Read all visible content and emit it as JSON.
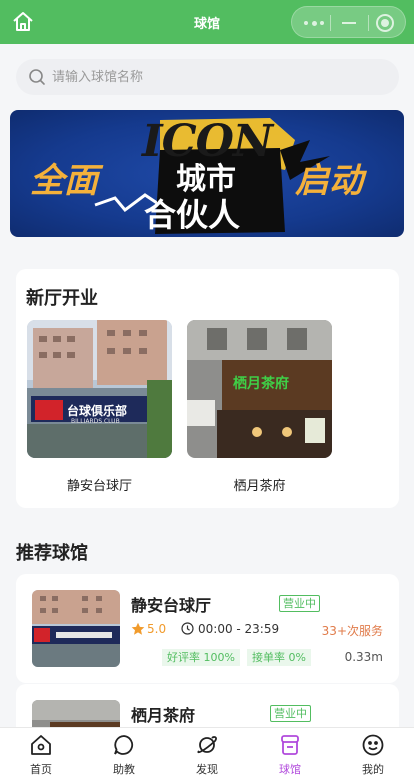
{
  "header": {
    "title": "球馆",
    "accent_color": "#52bd60"
  },
  "search": {
    "placeholder": "请输入球馆名称"
  },
  "banner": {
    "brand": "ICON",
    "left_text": "全面",
    "right_text": "启动",
    "center_line1": "城市",
    "center_line2": "合伙人"
  },
  "new_halls": {
    "title": "新厅开业",
    "items": [
      {
        "name": "静安台球厅",
        "sign_text": "台球俱乐部",
        "sign_sub": "BILLIARDS CLUB"
      },
      {
        "name": "栖月茶府",
        "sign_text": "栖月茶府"
      }
    ]
  },
  "recommended": {
    "title": "推荐球馆",
    "items": [
      {
        "name": "静安台球厅",
        "status": "营业中",
        "rating": "5.0",
        "hours": "00:00 - 23:59",
        "served": "33+次服务",
        "good_rate": "好评率 100%",
        "accept_rate": "接单率 0%",
        "distance": "0.33m"
      },
      {
        "name": "栖月茶府",
        "status": "营业中"
      }
    ]
  },
  "tabbar": {
    "active_color": "#b14adc",
    "tabs": [
      {
        "label": "首页",
        "icon": "home-icon"
      },
      {
        "label": "助教",
        "icon": "chat-icon"
      },
      {
        "label": "发现",
        "icon": "planet-icon"
      },
      {
        "label": "球馆",
        "icon": "hall-icon",
        "active": true
      },
      {
        "label": "我的",
        "icon": "smile-icon"
      }
    ]
  }
}
